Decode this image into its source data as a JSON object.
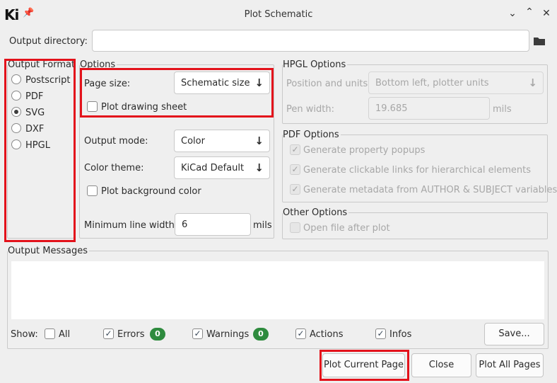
{
  "window": {
    "app_logo": "Ki",
    "pin_icon": "pin-icon",
    "title": "Plot Schematic",
    "controls": [
      "chevron-down-icon",
      "chevron-up-icon",
      "close-icon"
    ]
  },
  "output_directory": {
    "label": "Output directory:",
    "value": "",
    "folder_icon": "folder-icon"
  },
  "output_format": {
    "title": "Output Format",
    "options": [
      {
        "label": "Postscript",
        "selected": false
      },
      {
        "label": "PDF",
        "selected": false
      },
      {
        "label": "SVG",
        "selected": true
      },
      {
        "label": "DXF",
        "selected": false
      },
      {
        "label": "HPGL",
        "selected": false
      }
    ]
  },
  "options": {
    "title": "Options",
    "page_size_label": "Page size:",
    "page_size_value": "Schematic size",
    "plot_drawing_sheet": "Plot drawing sheet",
    "plot_drawing_sheet_checked": false,
    "output_mode_label": "Output mode:",
    "output_mode_value": "Color",
    "color_theme_label": "Color theme:",
    "color_theme_value": "KiCad Default",
    "plot_background": "Plot background color",
    "plot_background_checked": false,
    "min_line_width_label": "Minimum line width:",
    "min_line_width_value": "6",
    "min_line_width_unit": "mils"
  },
  "hpgl": {
    "title": "HPGL Options",
    "position_label": "Position and units:",
    "position_value": "Bottom left, plotter units",
    "pen_width_label": "Pen width:",
    "pen_width_value": "19.685",
    "pen_width_unit": "mils"
  },
  "pdf": {
    "title": "PDF Options",
    "items": [
      {
        "label": "Generate property popups",
        "checked": true
      },
      {
        "label": "Generate clickable links for hierarchical elements",
        "checked": true
      },
      {
        "label": "Generate metadata from AUTHOR & SUBJECT variables",
        "checked": true
      }
    ]
  },
  "other": {
    "title": "Other Options",
    "open_file": "Open file after plot",
    "open_file_checked": false
  },
  "messages": {
    "title": "Output Messages",
    "show_label": "Show:",
    "all": "All",
    "errors": "Errors",
    "errors_count": "0",
    "warnings": "Warnings",
    "warnings_count": "0",
    "actions": "Actions",
    "infos": "Infos",
    "save": "Save..."
  },
  "buttons": {
    "plot_current": "Plot Current Page",
    "close": "Close",
    "plot_all": "Plot All Pages"
  },
  "colors": {
    "highlight": "#e3121b",
    "badge": "#2e8b3e"
  }
}
